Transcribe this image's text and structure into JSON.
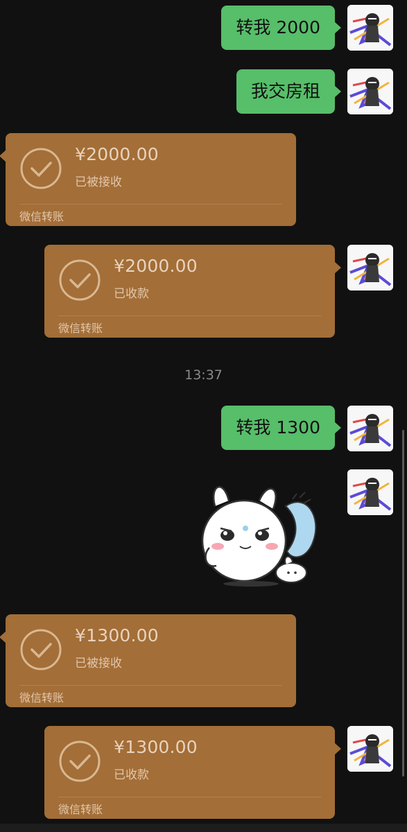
{
  "messages": {
    "msg1_text": "转我 2000",
    "msg2_text": "我交房租",
    "msg6_text": "转我 1300"
  },
  "transfers": [
    {
      "amount": "¥2000.00",
      "status": "已被接收",
      "brand": "微信转账"
    },
    {
      "amount": "¥2000.00",
      "status": "已收款",
      "brand": "微信转账"
    },
    {
      "amount": "¥1300.00",
      "status": "已被接收",
      "brand": "微信转账"
    },
    {
      "amount": "¥1300.00",
      "status": "已收款",
      "brand": "微信转账"
    }
  ],
  "timestamp": "13:37",
  "colors": {
    "background": "#111111",
    "sent_bubble": "#57be6a",
    "transfer_card": "#a36e37",
    "timestamp_text": "#8a8a8a"
  },
  "icons": {
    "received_check": "check-circle-icon",
    "sticker": "bunny-sticker"
  }
}
